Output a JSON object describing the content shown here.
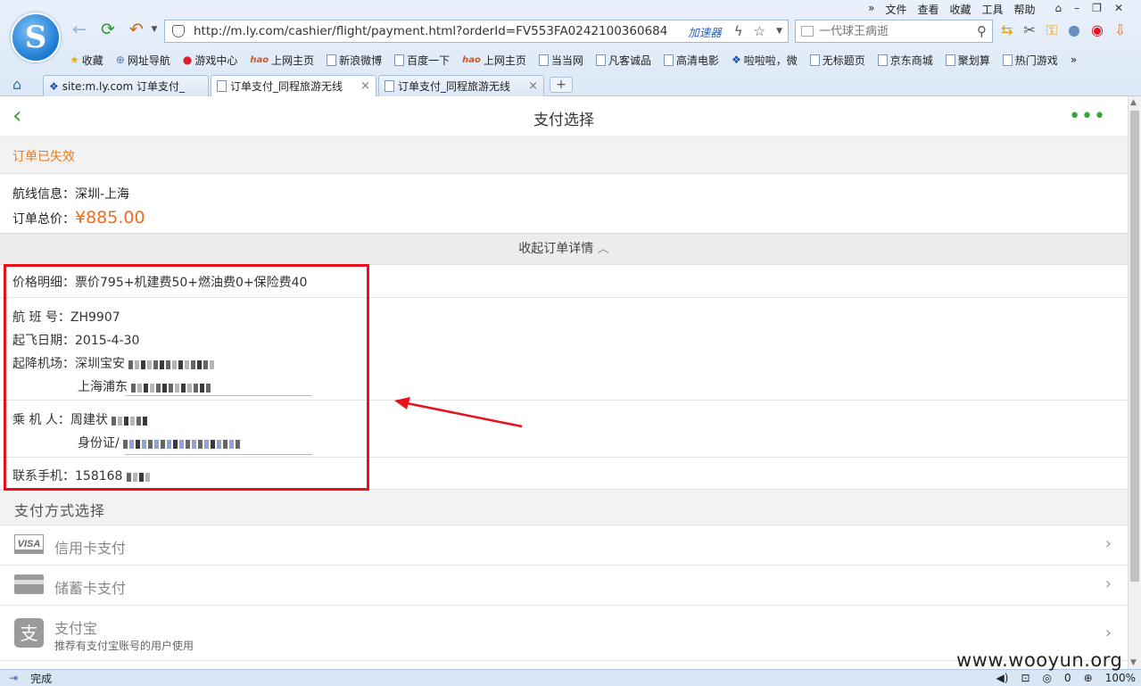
{
  "browser": {
    "menu": [
      "文件",
      "查看",
      "收藏",
      "工具",
      "帮助"
    ],
    "menu_overflow": "»",
    "url": "http://m.ly.com/cashier/flight/payment.html?orderId=FV553FA0242100360684",
    "accelerator": "加速器",
    "search_placeholder": "一代球王病逝",
    "bookmarks": [
      "收藏",
      "网址导航",
      "游戏中心",
      "上网主页",
      "新浪微博",
      "百度一下",
      "上网主页",
      "当当网",
      "凡客诚品",
      "高清电影",
      "啦啦啦，微",
      "无标题页",
      "京东商城",
      "聚划算",
      "热门游戏"
    ],
    "bookmarks_overflow": "»",
    "tabs": [
      {
        "label": "site:m.ly.com 订单支付_",
        "active": false
      },
      {
        "label": "订单支付_同程旅游无线",
        "active": true
      },
      {
        "label": "订单支付_同程旅游无线",
        "active": false
      }
    ],
    "new_tab": "+"
  },
  "page": {
    "title": "支付选择",
    "more": "•••",
    "status_text": "订单已失效",
    "route_label": "航线信息：",
    "route_value": "深圳-上海",
    "total_label": "订单总价：",
    "total_value": "¥885.00",
    "collapse_label": "收起订单详情",
    "price_label": "价格明细：",
    "price_value": "票价795+机建费50+燃油费0+保险费40",
    "flight_label": "航 班 号：",
    "flight_value": "ZH9907",
    "date_label": "起飞日期：",
    "date_value": "2015-4-30",
    "airport_label": "起降机场：",
    "airport_depart": "深圳宝安",
    "airport_arrive": "上海浦东",
    "passenger_label": "乘 机 人：",
    "passenger_name": "周建状",
    "passenger_id_label": "身份证/",
    "contact_label": "联系手机：",
    "contact_value": "158168",
    "pay_header": "支付方式选择",
    "pay_methods": [
      {
        "label": "信用卡支付",
        "icon": "visa-card-icon"
      },
      {
        "label": "储蓄卡支付",
        "icon": "debit-card-icon"
      },
      {
        "label": "支付宝",
        "sub": "推荐有支付宝账号的用户使用",
        "icon": "alipay-icon"
      }
    ]
  },
  "statusbar": {
    "status": "完成",
    "zoom": "100%",
    "count": "0"
  },
  "watermark": "www.wooyun.org",
  "colors": {
    "accent_green": "#3aa33a",
    "price_orange": "#f26a1b",
    "warning_orange": "#e87c18",
    "highlight_red": "#e8101a"
  }
}
